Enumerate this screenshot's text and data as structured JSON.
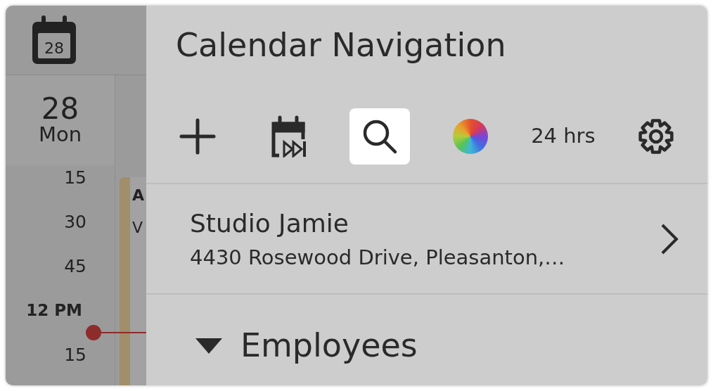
{
  "calendar": {
    "header_day": "28",
    "day_number": "28",
    "weekday": "Mon",
    "times": [
      {
        "label": "15",
        "kind": "minute"
      },
      {
        "label": "30",
        "kind": "minute"
      },
      {
        "label": "45",
        "kind": "minute"
      },
      {
        "label": "12 PM",
        "kind": "hour"
      },
      {
        "label": "15",
        "kind": "minute"
      }
    ],
    "event": {
      "title": "A",
      "subtitle": "V"
    }
  },
  "panel": {
    "title": "Calendar Navigation",
    "toolbar": [
      {
        "kind": "add",
        "selected": false
      },
      {
        "kind": "jump",
        "selected": false
      },
      {
        "kind": "search",
        "selected": true
      },
      {
        "kind": "colors",
        "selected": false
      },
      {
        "kind": "text",
        "label": "24 hrs",
        "selected": false
      },
      {
        "kind": "settings",
        "selected": false
      }
    ],
    "location": {
      "name": "Studio Jamie",
      "address": "4430 Rosewood Drive, Pleasanton,…"
    },
    "section": {
      "label": "Employees",
      "expanded": true
    }
  }
}
